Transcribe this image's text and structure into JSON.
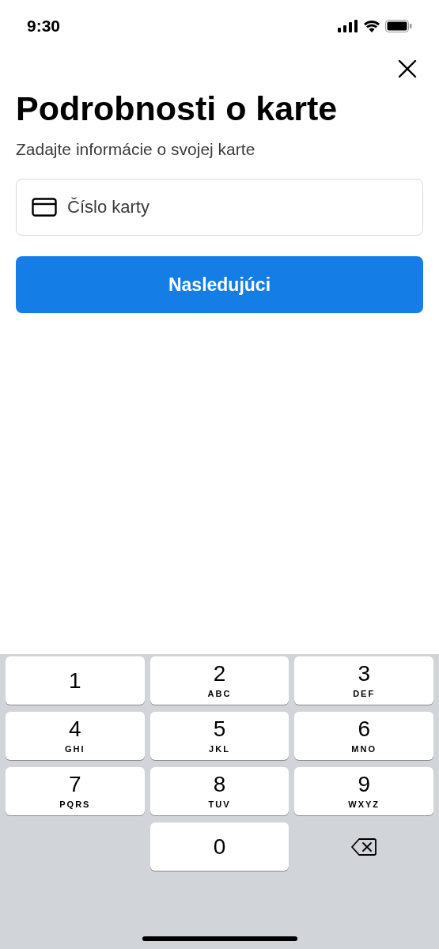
{
  "status_bar": {
    "time": "9:30"
  },
  "title": "Podrobnosti o karte",
  "subtitle": "Zadajte informácie o svojej karte",
  "card_field": {
    "placeholder": "Číslo karty"
  },
  "next_button": "Nasledujúci",
  "keypad": [
    {
      "kind": "key",
      "digit": "1"
    },
    {
      "kind": "key",
      "digit": "2",
      "letters": "ABC"
    },
    {
      "kind": "key",
      "digit": "3",
      "letters": "DEF"
    },
    {
      "kind": "key",
      "digit": "4",
      "letters": "GHI"
    },
    {
      "kind": "key",
      "digit": "5",
      "letters": "JKL"
    },
    {
      "kind": "key",
      "digit": "6",
      "letters": "MNO"
    },
    {
      "kind": "key",
      "digit": "7",
      "letters": "PQRS"
    },
    {
      "kind": "key",
      "digit": "8",
      "letters": "TUV"
    },
    {
      "kind": "key",
      "digit": "9",
      "letters": "WXYZ"
    },
    {
      "kind": "blank"
    },
    {
      "kind": "key",
      "digit": "0"
    },
    {
      "kind": "backspace"
    }
  ]
}
